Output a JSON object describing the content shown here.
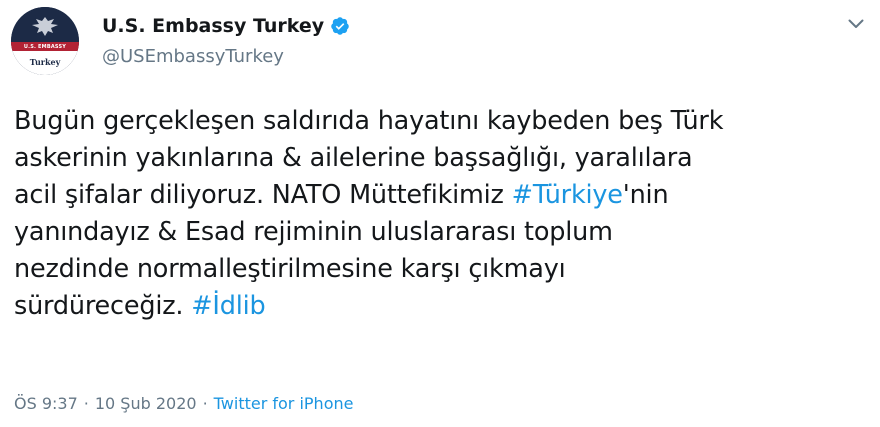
{
  "author": {
    "display_name": "U.S. Embassy Turkey",
    "handle": "@USEmbassyTurkey",
    "avatar_text_top": "U.S. EMBASSY",
    "avatar_text_bottom": "Turkey",
    "verified": true
  },
  "tweet": {
    "lines": [
      [
        {
          "text": "Bugün gerçekleşen saldırıda hayatını kaybeden beş Türk",
          "hashtag": false
        }
      ],
      [
        {
          "text": "askerinin yakınlarına & ailelerine başsağlığı, yaralılara",
          "hashtag": false
        }
      ],
      [
        {
          "text": "acil şifalar diliyoruz. NATO Müttefikimiz ",
          "hashtag": false
        },
        {
          "text": "#Türkiye",
          "hashtag": true
        },
        {
          "text": "'nin",
          "hashtag": false
        }
      ],
      [
        {
          "text": "yanındayız & Esad rejiminin uluslararası toplum",
          "hashtag": false
        }
      ],
      [
        {
          "text": "nezdinde normalleştirilmesine karşı çıkmayı",
          "hashtag": false
        }
      ],
      [
        {
          "text": "sürdüreceğiz. ",
          "hashtag": false
        },
        {
          "text": "#İdlib",
          "hashtag": true
        }
      ]
    ]
  },
  "meta": {
    "time": "ÖS 9:37",
    "separator": "·",
    "date": "10 Şub 2020",
    "source": "Twitter for iPhone"
  },
  "icons": {
    "verified": "verified-badge-icon",
    "menu": "chevron-down-icon"
  },
  "colors": {
    "link": "#1b95e0",
    "text": "#14171a",
    "secondary": "#657786",
    "avatar_bg": "#1c2a46",
    "avatar_band": "#b22234"
  }
}
